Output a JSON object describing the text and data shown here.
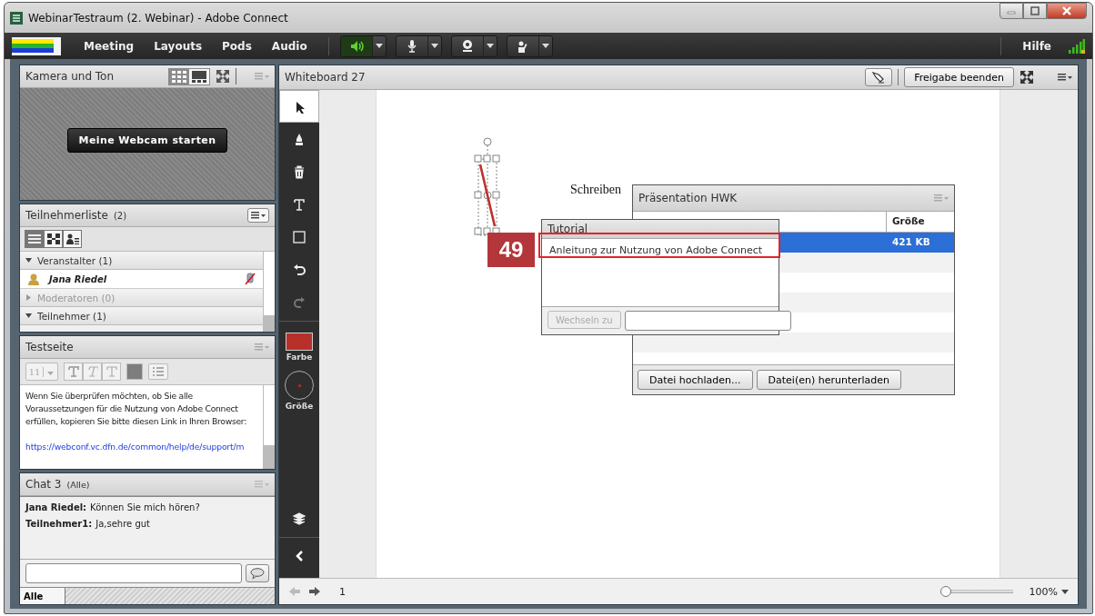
{
  "window": {
    "title": "WebinarTestraum (2. Webinar) - Adobe Connect"
  },
  "menu": [
    "Meeting",
    "Layouts",
    "Pods",
    "Audio"
  ],
  "speaker": {
    "on": true
  },
  "help": "Hilfe",
  "camera_pod": {
    "title": "Kamera und Ton",
    "layouts": [
      {
        "selected": true
      },
      {
        "selected": false
      }
    ],
    "button": "Meine Webcam starten"
  },
  "attendee_pod": {
    "title": "Teilnehmerliste",
    "count": "(2)",
    "views": [
      {
        "selected": true
      },
      {
        "selected": false
      },
      {
        "selected": false
      }
    ],
    "groups": [
      {
        "label": "Veranstalter (1)",
        "expanded": true,
        "disabled": false,
        "children": [
          {
            "name": "Jana Riedel",
            "mic_muted": true
          }
        ]
      },
      {
        "label": "Moderatoren (0)",
        "expanded": false,
        "disabled": true
      },
      {
        "label": "Teilnehmer (1)",
        "expanded": true,
        "disabled": false
      }
    ]
  },
  "notes_pod": {
    "title": "Testseite",
    "font_size": "11",
    "text": "Wenn Sie überprüfen möchten, ob Sie alle Voraussetzungen für die Nutzung von Adobe Connect erfüllen, kopieren Sie bitte diesen Link in Ihren Browser:",
    "link": "https://webconf.vc.dfn.de/common/help/de/support/m"
  },
  "chat_pod": {
    "title": "Chat 3",
    "scope": "(Alle)",
    "messages": [
      {
        "sender": "Jana Riedel:",
        "text": "Können Sie mich hören?"
      },
      {
        "sender": "Teilnehmer1:",
        "text": "Ja,sehre gut"
      }
    ],
    "tab": "Alle"
  },
  "whiteboard": {
    "title": "Whiteboard 27",
    "share_button": "Freigabe beenden",
    "tools": [
      {
        "kind": "select",
        "selected": true,
        "disabled": false
      },
      {
        "kind": "pen",
        "selected": false,
        "disabled": false
      },
      {
        "kind": "delete",
        "selected": false,
        "disabled": false
      },
      {
        "kind": "text",
        "selected": false,
        "disabled": false
      },
      {
        "kind": "shape",
        "selected": false,
        "disabled": false
      },
      {
        "kind": "undo",
        "selected": false,
        "disabled": false
      },
      {
        "kind": "redo",
        "selected": false,
        "disabled": true
      }
    ],
    "color_label": "Farbe",
    "size_label": "Größe",
    "canvas_text": "Schreiben",
    "page": "1",
    "zoom_slider": {
      "level": 0
    },
    "zoom": "100%"
  },
  "presentation_pod": {
    "title": "Präsentation HWK",
    "column": "Größe",
    "rows": [
      {
        "size": "421 KB",
        "selected": true
      }
    ],
    "buttons": [
      "Datei hochladen...",
      "Datei(en) herunterladen"
    ]
  },
  "tutorial_pod": {
    "title": "Tutorial",
    "items": [
      "Anleitung zur Nutzung von Adobe Connect"
    ],
    "button": "Wechseln zu",
    "button_disabled": true
  },
  "annotation": {
    "label": "49"
  }
}
